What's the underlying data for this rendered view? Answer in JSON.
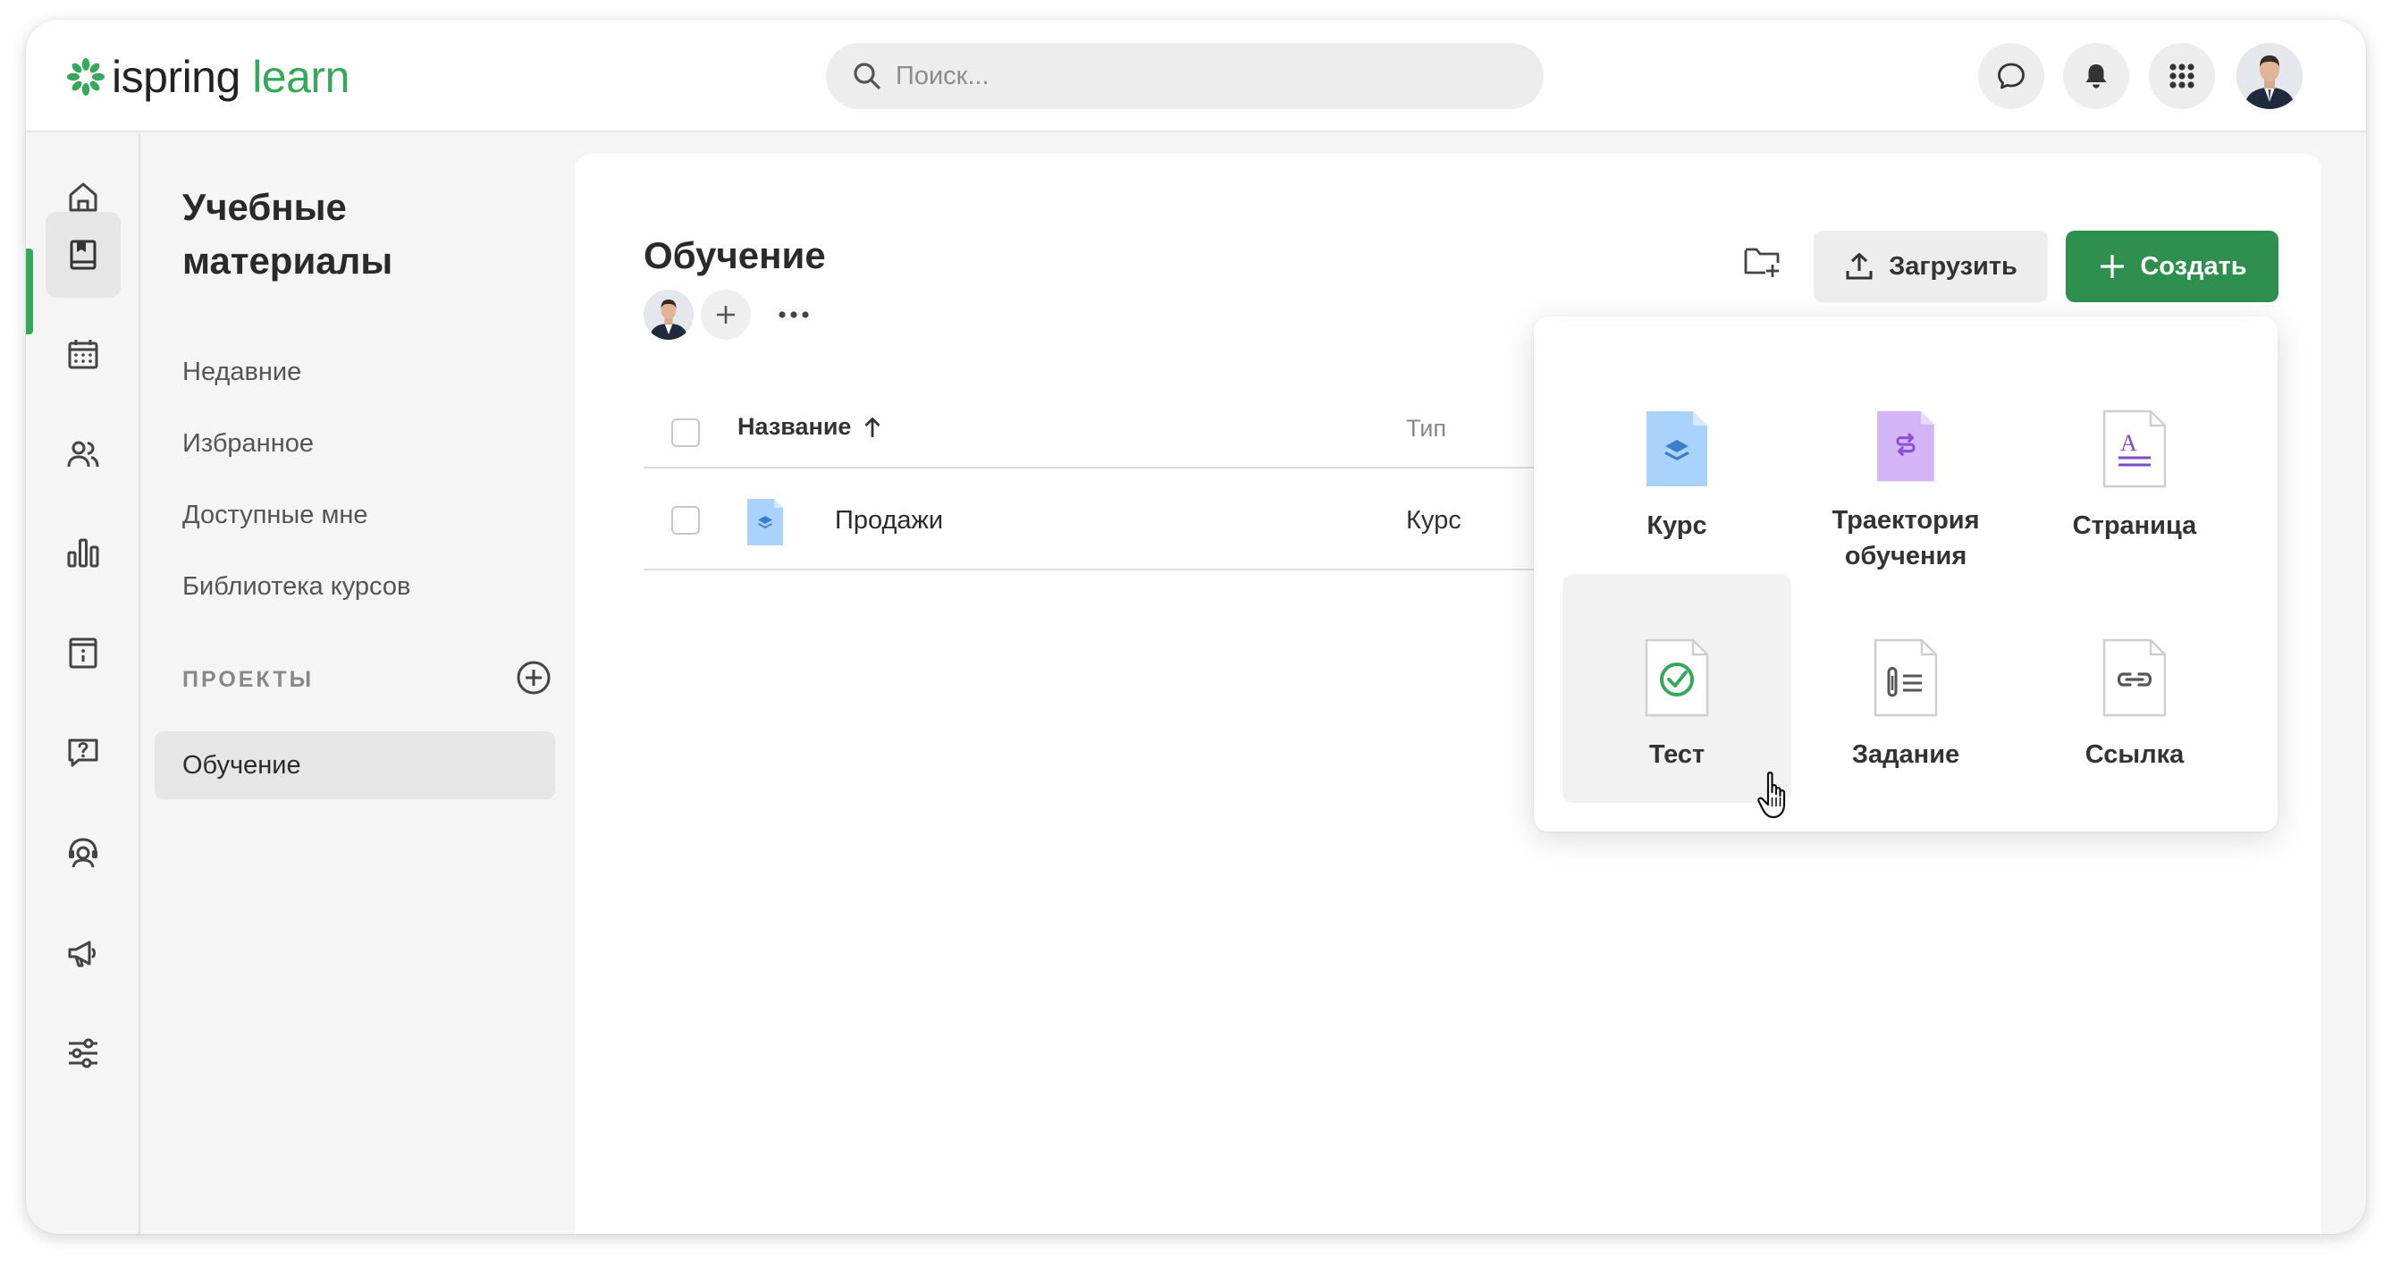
{
  "header": {
    "logo": {
      "part1": "ispring",
      "part2": "learn"
    },
    "search_placeholder": "Поиск...",
    "icons": [
      "chat-icon",
      "bell-icon",
      "apps-grid-icon"
    ]
  },
  "rail": {
    "items": [
      "home-icon",
      "materials-icon",
      "calendar-icon",
      "users-icon",
      "reports-icon",
      "info-board-icon",
      "help-icon",
      "support-agent-icon",
      "announcements-icon",
      "settings-sliders-icon"
    ],
    "active_index": 1
  },
  "sidebar": {
    "title": "Учебные материалы",
    "links": [
      "Недавние",
      "Избранное",
      "Доступные мне",
      "Библиотека курсов"
    ],
    "section_label": "ПРОЕКТЫ",
    "project": "Обучение"
  },
  "main": {
    "title": "Обучение",
    "upload_label": "Загрузить",
    "create_label": "Создать",
    "table": {
      "columns": [
        "Название",
        "Тип"
      ],
      "rows": [
        {
          "name": "Продажи",
          "type": "Курс"
        }
      ]
    }
  },
  "create_menu": {
    "items": [
      {
        "label": "Курс",
        "icon": "course-icon"
      },
      {
        "label": "Траектория обучения",
        "icon": "learning-path-icon"
      },
      {
        "label": "Страница",
        "icon": "page-icon"
      },
      {
        "label": "Тест",
        "icon": "test-icon"
      },
      {
        "label": "Задание",
        "icon": "assignment-icon"
      },
      {
        "label": "Ссылка",
        "icon": "link-icon"
      }
    ],
    "hovered": "Тест"
  },
  "colors": {
    "brand_green": "#2f8f4e",
    "course_blue": "#a9d3fb",
    "path_purple": "#d3b4f5",
    "test_green": "#36a85b"
  }
}
